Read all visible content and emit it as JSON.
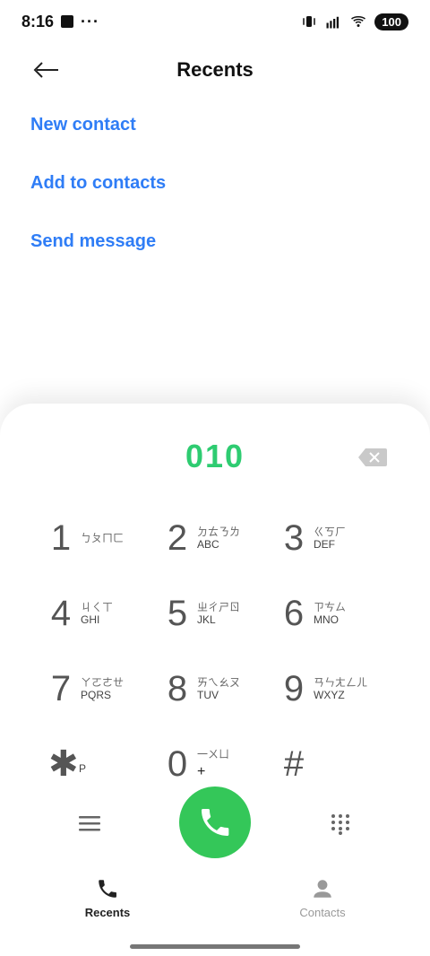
{
  "status": {
    "time": "8:16",
    "dots": "···",
    "battery": "100",
    "icons": {
      "square": "square-icon",
      "vibrate": "vibrate-icon",
      "signal": "signal-icon",
      "wifi": "wifi-icon",
      "battery": "battery-icon"
    }
  },
  "header": {
    "title": "Recents"
  },
  "actions": {
    "new_contact": "New contact",
    "add_to_contacts": "Add to contacts",
    "send_message": "Send message"
  },
  "dialer": {
    "number": "010",
    "keys": [
      {
        "digit": "1",
        "zh": "ㄅㄆㄇㄈ",
        "letters": ""
      },
      {
        "digit": "2",
        "zh": "ㄉㄊㄋㄌ",
        "letters": "ABC"
      },
      {
        "digit": "3",
        "zh": "ㄍㄎㄏ",
        "letters": "DEF"
      },
      {
        "digit": "4",
        "zh": "ㄐㄑㄒ",
        "letters": "GHI"
      },
      {
        "digit": "5",
        "zh": "ㄓㄔㄕㄖ",
        "letters": "JKL"
      },
      {
        "digit": "6",
        "zh": "ㄗㄘㄙ",
        "letters": "MNO"
      },
      {
        "digit": "7",
        "zh": "ㄚㄛㄜㄝ",
        "letters": "PQRS"
      },
      {
        "digit": "8",
        "zh": "ㄞㄟㄠㄡ",
        "letters": "TUV"
      },
      {
        "digit": "9",
        "zh": "ㄢㄣㄤㄥㄦ",
        "letters": "WXYZ"
      }
    ],
    "bottom_keys": {
      "star": {
        "symbol": "✱",
        "sub": "P"
      },
      "zero": {
        "digit": "0",
        "zh": "一ㄨㄩ",
        "plus": "+"
      },
      "hash": {
        "symbol": "#"
      }
    }
  },
  "nav": {
    "recents": "Recents",
    "contacts": "Contacts"
  },
  "colors": {
    "accent_blue": "#2f7df6",
    "accent_green": "#34c759",
    "number_green": "#2ecc71"
  }
}
